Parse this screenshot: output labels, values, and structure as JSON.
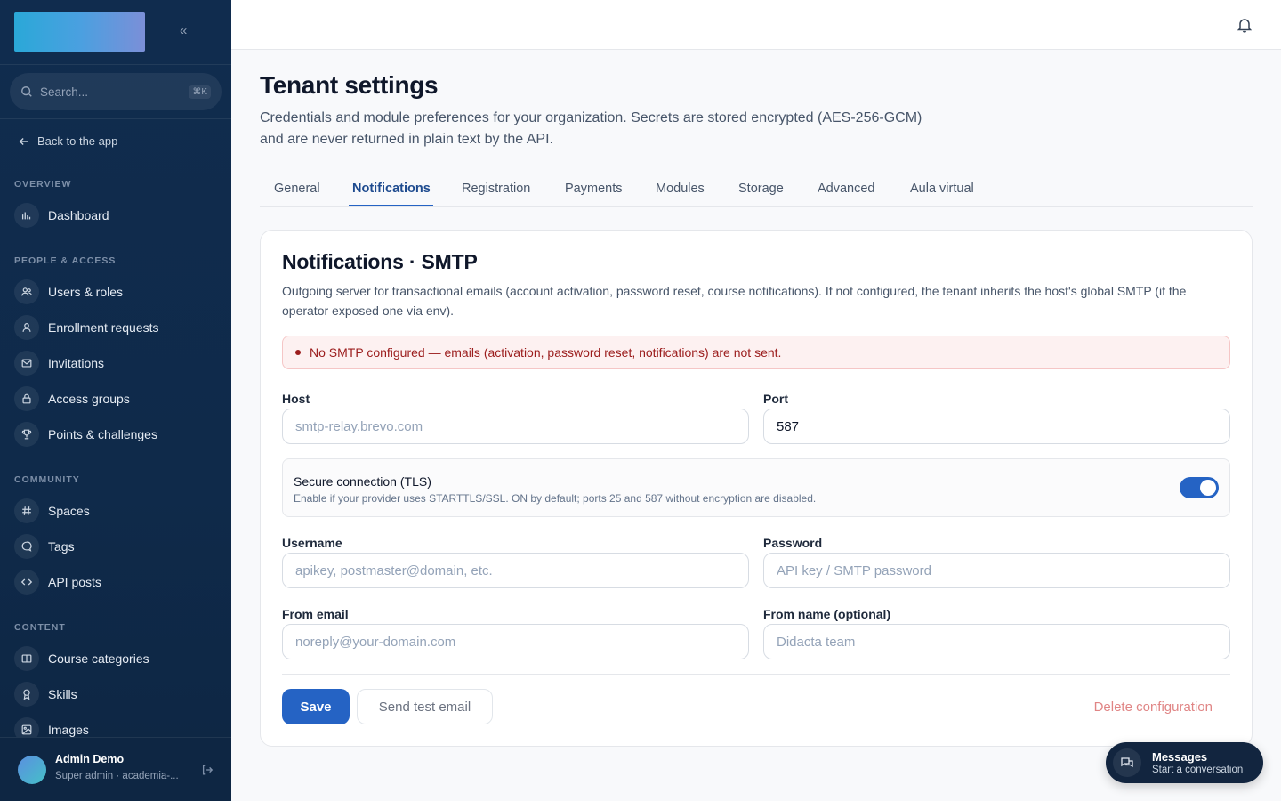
{
  "sidebar": {
    "collapse_glyph": "«",
    "search": {
      "placeholder": "Search...",
      "shortcut": "⌘K"
    },
    "back_label": "Back to the app",
    "sections": {
      "overview": "OVERVIEW",
      "people": "PEOPLE & ACCESS",
      "community": "COMMUNITY",
      "content": "CONTENT"
    },
    "items": {
      "dashboard": "Dashboard",
      "users": "Users & roles",
      "enrollment": "Enrollment requests",
      "invitations": "Invitations",
      "access_groups": "Access groups",
      "points": "Points & challenges",
      "spaces": "Spaces",
      "tags": "Tags",
      "api_posts": "API posts",
      "course_categories": "Course categories",
      "skills": "Skills",
      "images": "Images"
    },
    "user": {
      "name": "Admin Demo",
      "role": "Super admin · academia-..."
    }
  },
  "page": {
    "title": "Tenant settings",
    "subtitle": "Credentials and module preferences for your organization. Secrets are stored encrypted (AES-256-GCM) and are never returned in plain text by the API."
  },
  "tabs": {
    "general": "General",
    "notifications": "Notifications",
    "registration": "Registration",
    "payments": "Payments",
    "modules": "Modules",
    "storage": "Storage",
    "advanced": "Advanced",
    "aula": "Aula virtual"
  },
  "card": {
    "title": "Notifications · SMTP",
    "description": "Outgoing server for transactional emails (account activation, password reset, course notifications). If not configured, the tenant inherits the host's global SMTP (if the operator exposed one via env).",
    "alert": "No SMTP configured — emails (activation, password reset, notifications) are not sent.",
    "host": {
      "label": "Host",
      "placeholder": "smtp-relay.brevo.com",
      "value": ""
    },
    "port": {
      "label": "Port",
      "value": "587"
    },
    "tls": {
      "title": "Secure connection (TLS)",
      "description": "Enable if your provider uses STARTTLS/SSL. ON by default; ports 25 and 587 without encryption are disabled.",
      "enabled": true
    },
    "username": {
      "label": "Username",
      "placeholder": "apikey, postmaster@domain, etc."
    },
    "password": {
      "label": "Password",
      "placeholder": "API key / SMTP password"
    },
    "from_email": {
      "label": "From email",
      "placeholder": "noreply@your-domain.com"
    },
    "from_name": {
      "label": "From name (optional)",
      "placeholder": "Didacta team"
    },
    "save_label": "Save",
    "test_label": "Send test email",
    "delete_label": "Delete configuration"
  },
  "messages": {
    "title": "Messages",
    "subtitle": "Start a conversation"
  },
  "colors": {
    "accent": "#2563c4",
    "sidebar": "#102c4e",
    "danger": "#9b1c1c"
  }
}
